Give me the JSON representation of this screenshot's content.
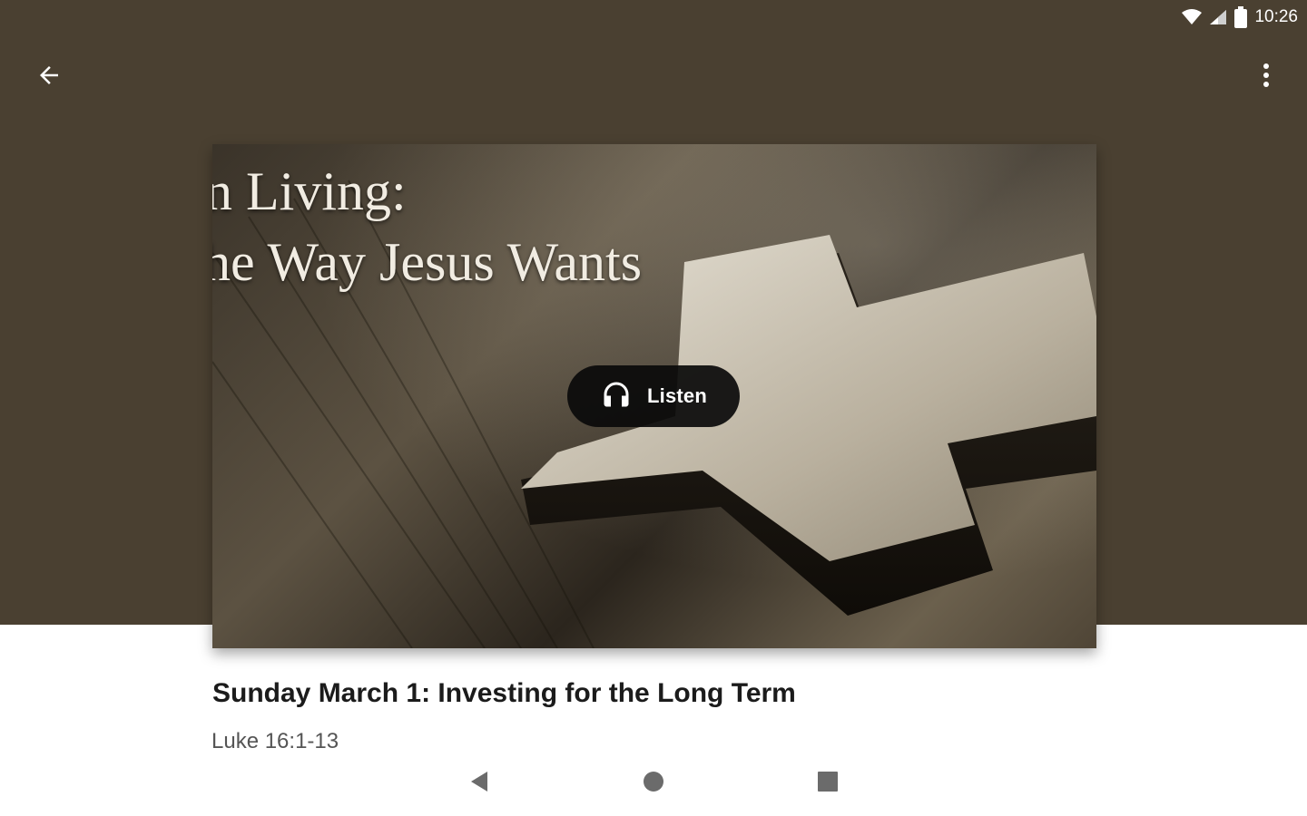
{
  "status_bar": {
    "time": "10:26",
    "icons": [
      "wifi-icon",
      "cell-signal-icon",
      "battery-icon"
    ]
  },
  "app_bar": {
    "back_icon": "arrow-back-icon",
    "more_icon": "more-vert-icon"
  },
  "hero": {
    "title_line_1": "n Living:",
    "title_line_2": "he Way Jesus Wants",
    "listen_label": "Listen",
    "listen_icon": "headphones-icon"
  },
  "sermon": {
    "title": "Sunday March 1: Investing for the Long Term",
    "reference": "Luke 16:1-13"
  },
  "nav_bar": {
    "back_icon": "nav-back-icon",
    "home_icon": "nav-home-icon",
    "recents_icon": "nav-recents-icon"
  },
  "colors": {
    "header_background": "#4a4031",
    "listen_button": "#0a0a0a",
    "title_text": "#1b1b1b",
    "reference_text": "#555555"
  }
}
